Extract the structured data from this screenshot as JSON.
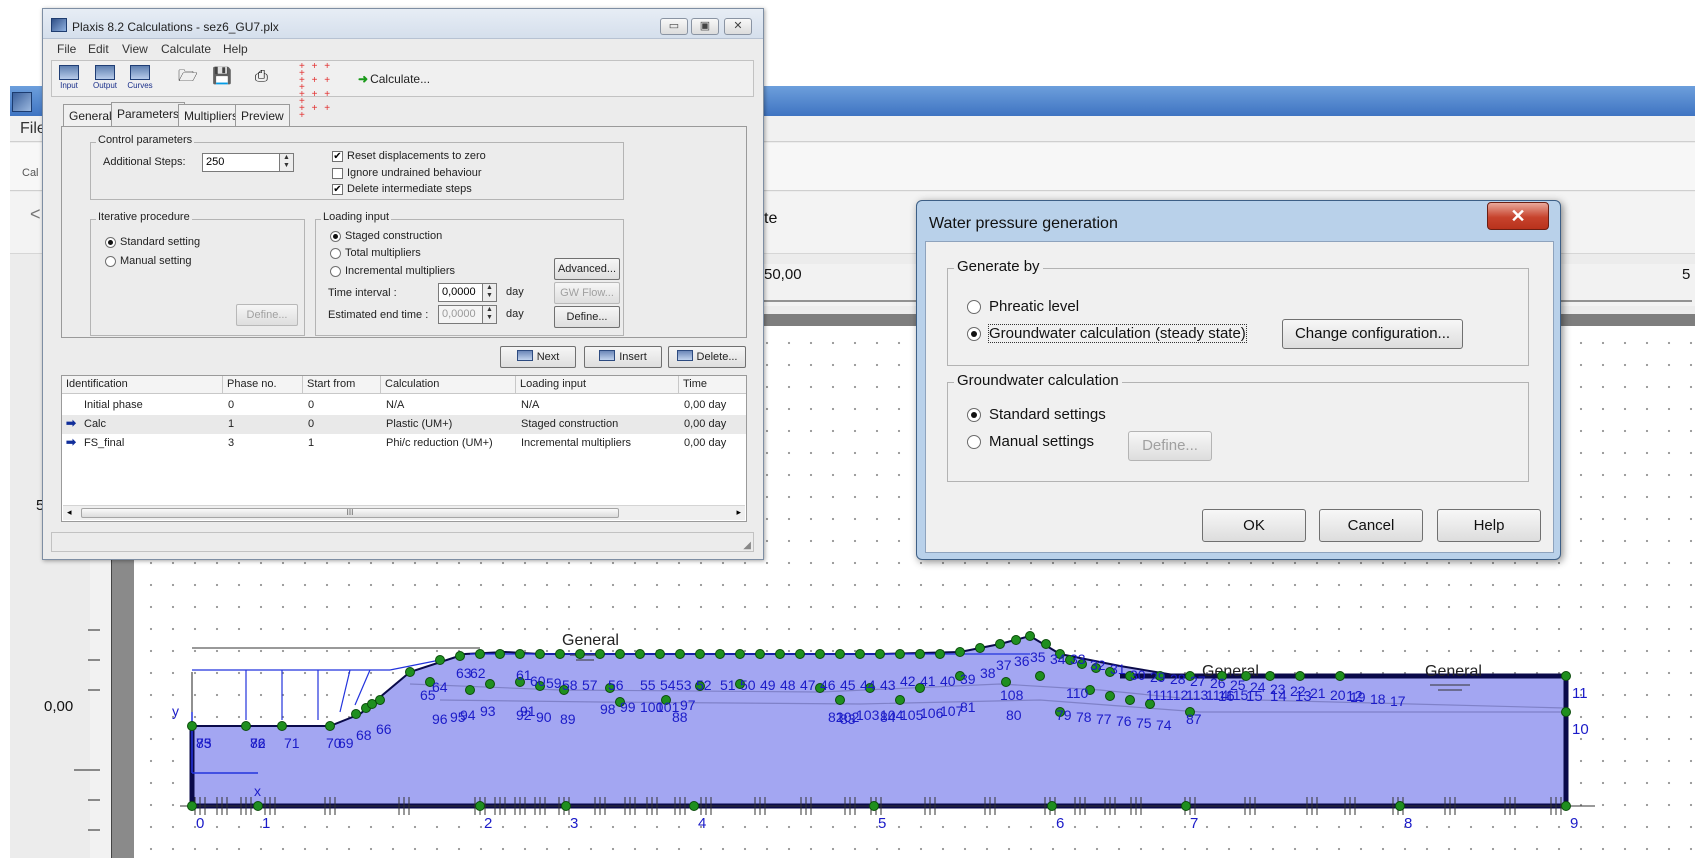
{
  "background": {
    "menu_file": "File",
    "toolbar_fragment": "Cal",
    "subbar_fragment": "te",
    "ruler_label": "50,00",
    "ruler_label_right": "5",
    "axis_zero": "0,00",
    "axis_five": "5",
    "model_labels": {
      "general": "General",
      "x_axis": "x",
      "y_axis": "y",
      "ground_point_numbers": [
        "0",
        "1",
        "2",
        "3",
        "4",
        "5",
        "6",
        "7",
        "8",
        "9"
      ],
      "right_boundary_numbers": [
        "10",
        "11",
        "12",
        "13",
        "14",
        "15",
        "16"
      ],
      "lower_point_numbers": [
        "73",
        "72",
        "71",
        "70",
        "69",
        "68",
        "66",
        "65",
        "64",
        "63",
        "62",
        "61",
        "60",
        "59",
        "58",
        "57",
        "56",
        "55",
        "54",
        "53",
        "52",
        "51",
        "50",
        "49",
        "48",
        "47",
        "46",
        "45",
        "44",
        "43",
        "42",
        "41",
        "40",
        "39",
        "38",
        "37",
        "36",
        "35",
        "34",
        "33",
        "32",
        "31",
        "30",
        "29",
        "28",
        "27",
        "26",
        "25",
        "24",
        "23",
        "22",
        "21",
        "20",
        "19",
        "18",
        "17",
        "108",
        "110",
        "111",
        "112",
        "113",
        "114",
        "115",
        "80",
        "79",
        "78",
        "77",
        "76",
        "75",
        "74",
        "87",
        "88",
        "89",
        "90",
        "91",
        "92",
        "93",
        "94",
        "95",
        "96",
        "97",
        "98",
        "99",
        "100",
        "101",
        "102",
        "103",
        "104",
        "105",
        "106",
        "107",
        "81",
        "82",
        "83",
        "84",
        "85",
        "86"
      ]
    }
  },
  "calc_window": {
    "title": "Plaxis 8.2 Calculations - sez6_GU7.plx",
    "menu": [
      "File",
      "Edit",
      "View",
      "Calculate",
      "Help"
    ],
    "toolbar": {
      "input": "Input",
      "output": "Output",
      "curves": "Curves",
      "calculate": "Calculate..."
    },
    "tabs": [
      "General",
      "Parameters",
      "Multipliers",
      "Preview"
    ],
    "control_parameters": {
      "legend": "Control parameters",
      "additional_steps_label": "Additional Steps:",
      "additional_steps_value": "250",
      "reset_displacements": "Reset displacements to zero",
      "ignore_undrained": "Ignore undrained behaviour",
      "delete_intermediate": "Delete intermediate steps"
    },
    "iterative_procedure": {
      "legend": "Iterative procedure",
      "standard": "Standard setting",
      "manual": "Manual setting",
      "define": "Define..."
    },
    "loading_input": {
      "legend": "Loading input",
      "staged": "Staged construction",
      "total": "Total multipliers",
      "incremental": "Incremental multipliers",
      "time_interval_label": "Time interval :",
      "time_interval_value": "0,0000",
      "end_time_label": "Estimated end time :",
      "end_time_value": "0,0000",
      "unit": "day",
      "advanced": "Advanced...",
      "gw_flow": "GW Flow...",
      "define": "Define..."
    },
    "phase_buttons": {
      "next": "Next",
      "insert": "Insert",
      "delete": "Delete..."
    },
    "phase_table": {
      "columns": [
        "Identification",
        "Phase no.",
        "Start from",
        "Calculation",
        "Loading input",
        "Time"
      ],
      "rows": [
        {
          "identification": "Initial phase",
          "phase_no": "0",
          "start_from": "0",
          "calculation": "N/A",
          "loading_input": "N/A",
          "time": "0,00 day"
        },
        {
          "identification": "Calc",
          "phase_no": "1",
          "start_from": "0",
          "calculation": "Plastic (UM+)",
          "loading_input": "Staged construction",
          "time": "0,00 day"
        },
        {
          "identification": "FS_final",
          "phase_no": "3",
          "start_from": "1",
          "calculation": "Phi/c reduction (UM+)",
          "loading_input": "Incremental multipliers",
          "time": "0,00 day"
        }
      ],
      "scroll_grip": "III"
    }
  },
  "water_dialog": {
    "title": "Water pressure generation",
    "close": "✕",
    "generate_by": {
      "legend": "Generate by",
      "phreatic": "Phreatic level",
      "groundwater": "Groundwater calculation (steady state)",
      "change_configuration": "Change configuration..."
    },
    "groundwater_calculation": {
      "legend": "Groundwater calculation",
      "standard": "Standard settings",
      "manual": "Manual settings",
      "define": "Define..."
    },
    "buttons": {
      "ok": "OK",
      "cancel": "Cancel",
      "help": "Help"
    }
  },
  "colors": {
    "soil_fill": "#a3a6f2",
    "model_outline": "#0a0a4a",
    "node_green": "#1f8f1f",
    "label_blue": "#1b1bc8",
    "load_blue": "#2233dd",
    "dialog_frame": "#b9d1ea",
    "close_red": "#c7432d"
  }
}
